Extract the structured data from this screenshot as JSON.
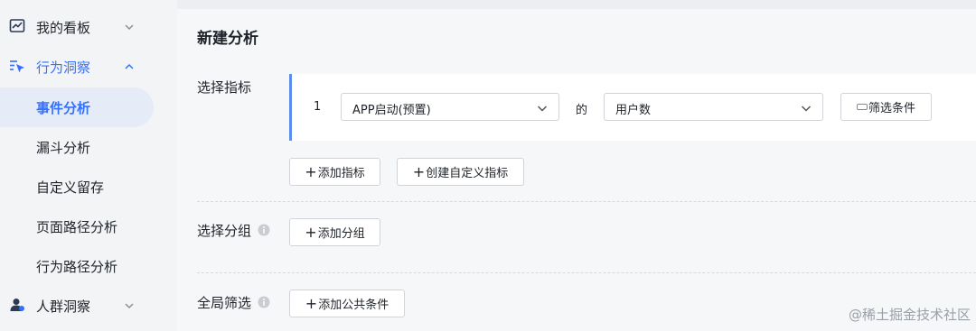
{
  "sidebar": {
    "items": [
      {
        "label": "我的看板",
        "icon": "chart-line-icon",
        "expandable": true
      },
      {
        "label": "行为洞察",
        "icon": "cursor-pointer-icon",
        "expandable": true,
        "expanded": true
      },
      {
        "label": "事件分析",
        "active": true
      },
      {
        "label": "漏斗分析"
      },
      {
        "label": "自定义留存"
      },
      {
        "label": "页面路径分析"
      },
      {
        "label": "行为路径分析"
      },
      {
        "label": "人群洞察",
        "icon": "user-group-icon",
        "expandable": true
      }
    ]
  },
  "main": {
    "title": "新建分析",
    "metric_section": {
      "label": "选择指标",
      "row": {
        "index": "1",
        "event_select": "APP启动(预置)",
        "of_text": "的",
        "measure_select": "用户数",
        "filter_button": "筛选条件"
      },
      "add_metric": "添加指标",
      "create_custom_metric": "创建自定义指标"
    },
    "group_section": {
      "label": "选择分组",
      "add_group": "添加分组"
    },
    "filter_section": {
      "label": "全局筛选",
      "add_condition": "添加公共条件"
    }
  },
  "watermark": "@稀土掘金技术社区",
  "colors": {
    "accent": "#3370ff",
    "active_bg": "#e6ebf8",
    "card_border": "#5b8def"
  }
}
